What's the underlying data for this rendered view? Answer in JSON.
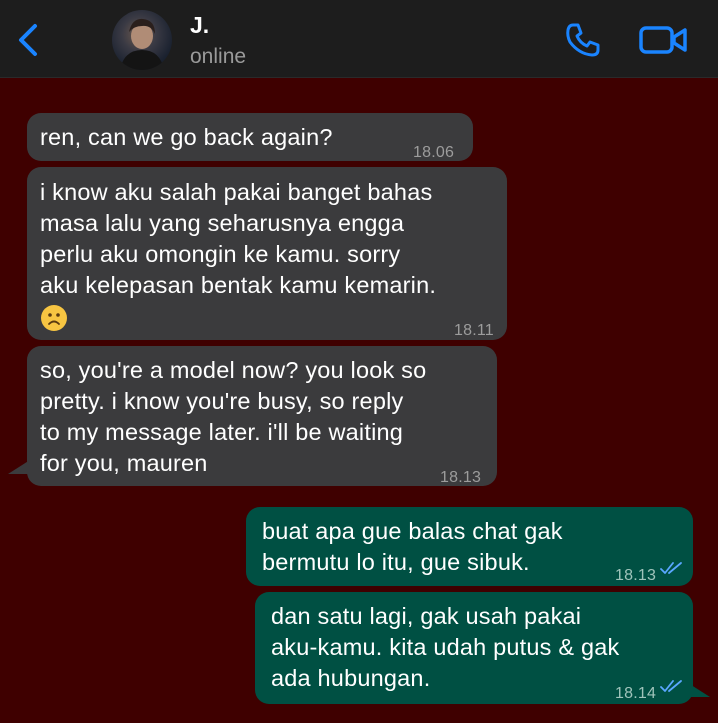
{
  "header": {
    "contact_name": "J.",
    "status": "online",
    "back_icon": "chevron-left-icon",
    "call_icon": "phone-icon",
    "video_icon": "video-camera-icon",
    "accent_color": "#1a84ff"
  },
  "messages": [
    {
      "direction": "incoming",
      "text": "ren, can we go back again?",
      "time": "18.06"
    },
    {
      "direction": "incoming",
      "text": "i know aku salah pakai banget bahas\nmasa lalu yang seharusnya engga\nperlu aku omongin ke kamu. sorry\naku kelepasan bentak kamu kemarin.",
      "emoji": "frowning-face-icon",
      "time": "18.11"
    },
    {
      "direction": "incoming",
      "text": "so, you're a model now? you look so\npretty. i know you're busy, so reply\nto my message later. i'll be waiting\nfor you, mauren",
      "time": "18.13"
    },
    {
      "direction": "outgoing",
      "text": "buat apa gue balas chat gak\nbermutu lo itu, gue sibuk.",
      "time": "18.13",
      "status": "read"
    },
    {
      "direction": "outgoing",
      "text": "dan satu lagi, gak usah pakai\naku-kamu. kita udah putus & gak\nada hubungan.",
      "time": "18.14",
      "status": "read"
    }
  ],
  "colors": {
    "chat_background": "#3f0000",
    "incoming_bubble": "#3b3b3d",
    "outgoing_bubble": "#005043",
    "read_ticks": "#5aa7ff"
  }
}
